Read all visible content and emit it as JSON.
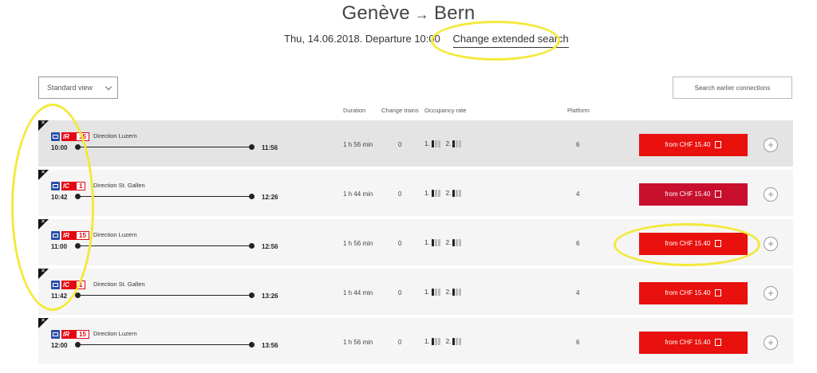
{
  "header": {
    "from": "Genève",
    "arrow": "→",
    "to": "Bern",
    "subtitle": "Thu, 14.06.2018. Departure 10:00",
    "change_link": "Change extended search"
  },
  "toolbar": {
    "view_select": "Standard view",
    "earlier_button": "Search earlier connections"
  },
  "columns": {
    "duration": "Duration",
    "change_trains": "Change trains",
    "occupancy": "Occupancy rate",
    "platform": "Platform"
  },
  "occupancy_labels": {
    "first": "1.",
    "second": "2."
  },
  "connections": [
    {
      "category": "IR",
      "number": "15",
      "direction": "Direction Luzern",
      "departure": "10:00",
      "arrival": "11:56",
      "duration": "1 h 56 min",
      "changes": "0",
      "platform": "6",
      "price": "from CHF 15.40",
      "corner": "✕",
      "plus": "+"
    },
    {
      "category": "IC",
      "number": "1",
      "direction": "Direction St. Gallen",
      "departure": "10:42",
      "arrival": "12:26",
      "duration": "1 h 44 min",
      "changes": "0",
      "platform": "4",
      "price": "from CHF 15.40",
      "corner": "✕",
      "plus": "+"
    },
    {
      "category": "IR",
      "number": "15",
      "direction": "Direction Luzern",
      "departure": "11:00",
      "arrival": "12:56",
      "duration": "1 h 56 min",
      "changes": "0",
      "platform": "6",
      "price": "from CHF 15.40",
      "corner": "✕",
      "plus": "+"
    },
    {
      "category": "IC",
      "number": "1",
      "direction": "Direction St. Gallen",
      "departure": "11:42",
      "arrival": "13:26",
      "duration": "1 h 44 min",
      "changes": "0",
      "platform": "4",
      "price": "from CHF 15.40",
      "corner": "✕",
      "plus": "+"
    },
    {
      "category": "IR",
      "number": "15",
      "direction": "Direction Luzern",
      "departure": "12:00",
      "arrival": "13:56",
      "duration": "1 h 56 min",
      "changes": "0",
      "platform": "6",
      "price": "from CHF 15.40",
      "corner": "✕",
      "plus": "+"
    }
  ],
  "colors": {
    "brand_red": "#e8110d",
    "hover_red": "#c8102e",
    "annotation_yellow": "#f3e93b",
    "row_bg_selected": "#e6e6e6",
    "row_bg": "#f5f5f5"
  }
}
